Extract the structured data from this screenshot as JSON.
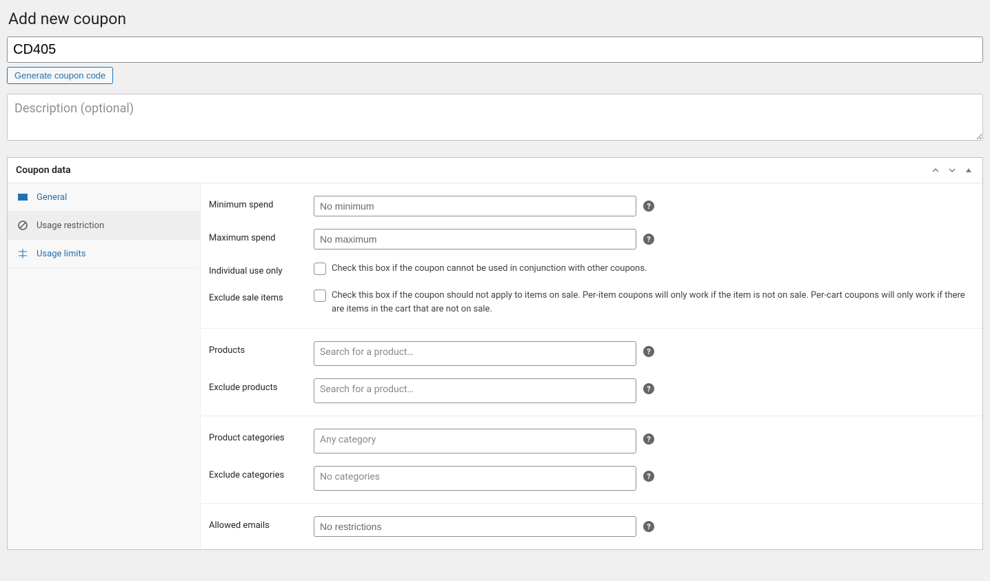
{
  "page": {
    "title": "Add new coupon"
  },
  "coupon": {
    "code": "CD405",
    "generate_button": "Generate coupon code",
    "description_placeholder": "Description (optional)"
  },
  "panel": {
    "title": "Coupon data"
  },
  "tabs": {
    "general": "General",
    "usage_restriction": "Usage restriction",
    "usage_limits": "Usage limits"
  },
  "fields": {
    "minimum_spend": {
      "label": "Minimum spend",
      "placeholder": "No minimum"
    },
    "maximum_spend": {
      "label": "Maximum spend",
      "placeholder": "No maximum"
    },
    "individual_use": {
      "label": "Individual use only",
      "description": "Check this box if the coupon cannot be used in conjunction with other coupons."
    },
    "exclude_sale": {
      "label": "Exclude sale items",
      "description": "Check this box if the coupon should not apply to items on sale. Per-item coupons will only work if the item is not on sale. Per-cart coupons will only work if there are items in the cart that are not on sale."
    },
    "products": {
      "label": "Products",
      "placeholder": "Search for a product…"
    },
    "exclude_products": {
      "label": "Exclude products",
      "placeholder": "Search for a product…"
    },
    "product_categories": {
      "label": "Product categories",
      "placeholder": "Any category"
    },
    "exclude_categories": {
      "label": "Exclude categories",
      "placeholder": "No categories"
    },
    "allowed_emails": {
      "label": "Allowed emails",
      "placeholder": "No restrictions"
    }
  }
}
